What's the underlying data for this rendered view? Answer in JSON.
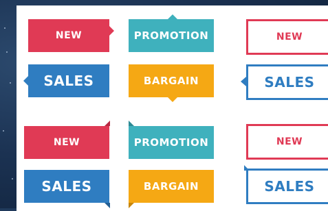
{
  "labels": {
    "new": "NEW",
    "sales": "SALES",
    "promotion": "PROMOTION",
    "bargain": "BARGAIN"
  },
  "colors": {
    "red": "#e03a55",
    "teal": "#3fb1bd",
    "blue": "#2f7dc1",
    "orange": "#f5a814"
  }
}
